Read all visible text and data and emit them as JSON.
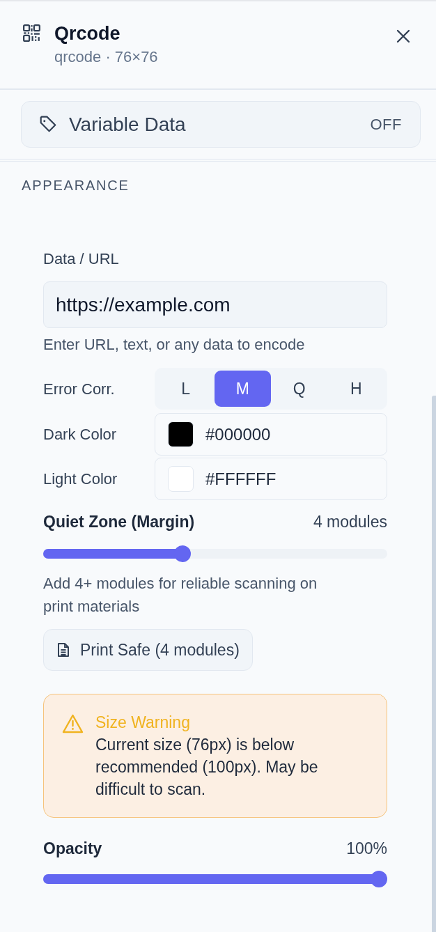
{
  "header": {
    "title": "Qrcode",
    "subtitle": "qrcode · 76×76"
  },
  "variable_data": {
    "label": "Variable Data",
    "status": "OFF"
  },
  "section": {
    "title": "APPEARANCE"
  },
  "data_url": {
    "label": "Data / URL",
    "value": "https://example.com",
    "hint": "Enter URL, text, or any data to encode"
  },
  "error_correction": {
    "label": "Error Corr.",
    "options": [
      {
        "label": "L",
        "selected": false
      },
      {
        "label": "M",
        "selected": true
      },
      {
        "label": "Q",
        "selected": false
      },
      {
        "label": "H",
        "selected": false
      }
    ]
  },
  "colors": [
    {
      "label": "Dark Color",
      "value": "#000000",
      "color": "#000000"
    },
    {
      "label": "Light Color",
      "value": "#FFFFFF",
      "color": "#ffffff"
    }
  ],
  "quiet_zone": {
    "label": "Quiet Zone (Margin)",
    "reading": "4 modules",
    "level": 0.4,
    "hint": "Add 4+ modules for reliable scanning on print materials",
    "preset_button": "Print Safe (4 modules)"
  },
  "warning": {
    "title": "Size Warning",
    "message": "Current size (76px) is below recommended (100px). May be difficult to scan."
  },
  "opacity": {
    "label": "Opacity",
    "reading": "100%",
    "level": 1
  }
}
